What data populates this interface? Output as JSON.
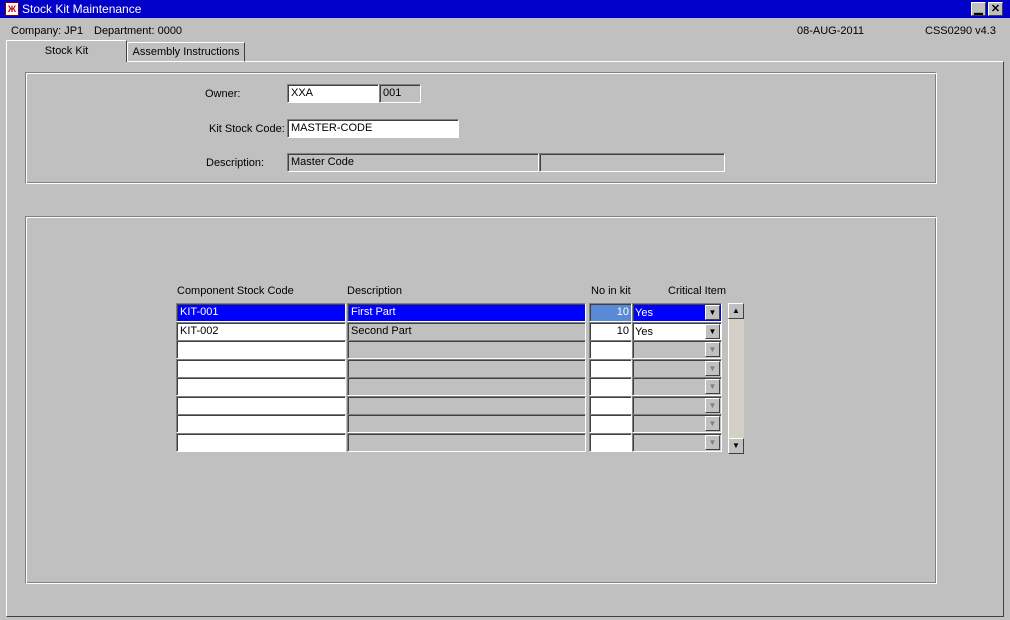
{
  "window": {
    "title": "Stock Kit Maintenance",
    "icon": "app-icon"
  },
  "info": {
    "company": "Company:  JP1",
    "department": "Department:  0000",
    "date": "08-AUG-2011",
    "program": "CSS0290  v4.3"
  },
  "tabs": [
    {
      "label": "Stock Kit",
      "active": true
    },
    {
      "label": "Assembly Instructions",
      "active": false
    }
  ],
  "header": {
    "owner_label": "Owner:",
    "owner_code": "XXA",
    "owner_number": "001",
    "kit_label": "Kit Stock Code:",
    "kit_code": "MASTER-CODE",
    "desc_label": "Description:",
    "desc_value": "Master Code",
    "desc_value2": ""
  },
  "grid": {
    "columns": [
      "Component Stock Code",
      "Description",
      "No in kit",
      "Critical Item"
    ],
    "rows": [
      {
        "code": "KIT-001",
        "description": "First Part",
        "qty": "10",
        "critical": "Yes"
      },
      {
        "code": "KIT-002",
        "description": "Second Part",
        "qty": "10",
        "critical": "Yes"
      },
      {
        "code": "",
        "description": "",
        "qty": "",
        "critical": ""
      },
      {
        "code": "",
        "description": "",
        "qty": "",
        "critical": ""
      },
      {
        "code": "",
        "description": "",
        "qty": "",
        "critical": ""
      },
      {
        "code": "",
        "description": "",
        "qty": "",
        "critical": ""
      },
      {
        "code": "",
        "description": "",
        "qty": "",
        "critical": ""
      },
      {
        "code": "",
        "description": "",
        "qty": "",
        "critical": ""
      }
    ]
  },
  "colors": {
    "titlebar": "#0000c8",
    "selection": "#0000ff",
    "qty_selection": "#5a8ad6"
  }
}
